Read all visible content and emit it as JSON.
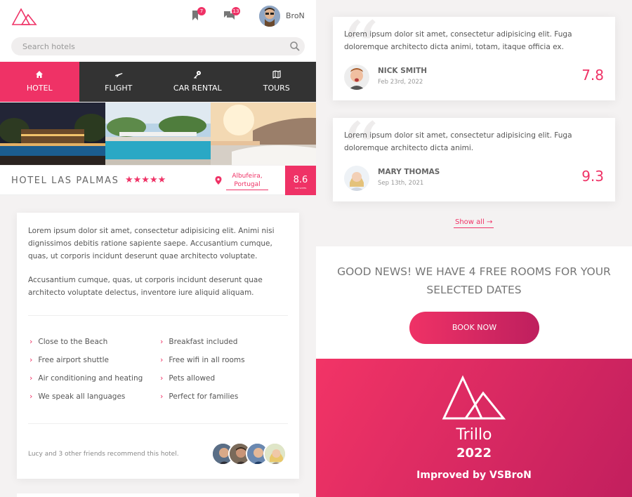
{
  "header": {
    "search_placeholder": "Search hotels",
    "bookmarks_count": "7",
    "messages_count": "13",
    "user_name": "BroN"
  },
  "nav": [
    {
      "label": "HOTEL",
      "icon": "home-icon",
      "active": true
    },
    {
      "label": "FLIGHT",
      "icon": "plane-icon",
      "active": false
    },
    {
      "label": "CAR RENTAL",
      "icon": "key-icon",
      "active": false
    },
    {
      "label": "TOURS",
      "icon": "map-icon",
      "active": false
    }
  ],
  "hotel": {
    "name": "HOTEL LAS PALMAS",
    "stars": "★★★★★",
    "location_line1": "Albufeira,",
    "location_line2": "Portugal",
    "rating": "8.6",
    "rating_label": "300 VOTES"
  },
  "description": {
    "p1": "Lorem ipsum dolor sit amet, consectetur adipisicing elit. Animi nisi dignissimos debitis ratione sapiente saepe. Accusantium cumque, quas, ut corporis incidunt deserunt quae architecto voluptate.",
    "p2": "Accusantium cumque, quas, ut corporis incidunt deserunt quae architecto voluptate delectus, inventore iure aliquid aliquam."
  },
  "features": [
    "Close to the Beach",
    "Breakfast included",
    "Free airport shuttle",
    "Free wifi in all rooms",
    "Air conditioning and heating",
    "Pets allowed",
    "We speak all languages",
    "Perfect for families"
  ],
  "recommend_text": "Lucy and 3 other friends recommend this hotel.",
  "reviews": [
    {
      "text": "Lorem ipsum dolor sit amet, consectetur adipisicing elit. Fuga doloremque architecto dicta animi, totam, itaque officia ex.",
      "name": "NICK SMITH",
      "date": "Feb 23rd, 2022",
      "score": "7.8"
    },
    {
      "text": "Lorem ipsum dolor sit amet, consectetur adipisicing elit. Fuga doloremque architecto dicta animi.",
      "name": "MARY THOMAS",
      "date": "Sep 13th, 2021",
      "score": "9.3"
    }
  ],
  "show_all": "Show all →",
  "cta": {
    "text": "GOOD NEWS! WE HAVE 4 FREE ROOMS FOR YOUR SELECTED DATES",
    "button": "BOOK NOW"
  },
  "brand": {
    "name": "Trillo",
    "year": "2022",
    "improved_by": "Improved by VSBroN"
  },
  "colors": {
    "accent": "#ef3266",
    "dark_nav": "#333333"
  }
}
